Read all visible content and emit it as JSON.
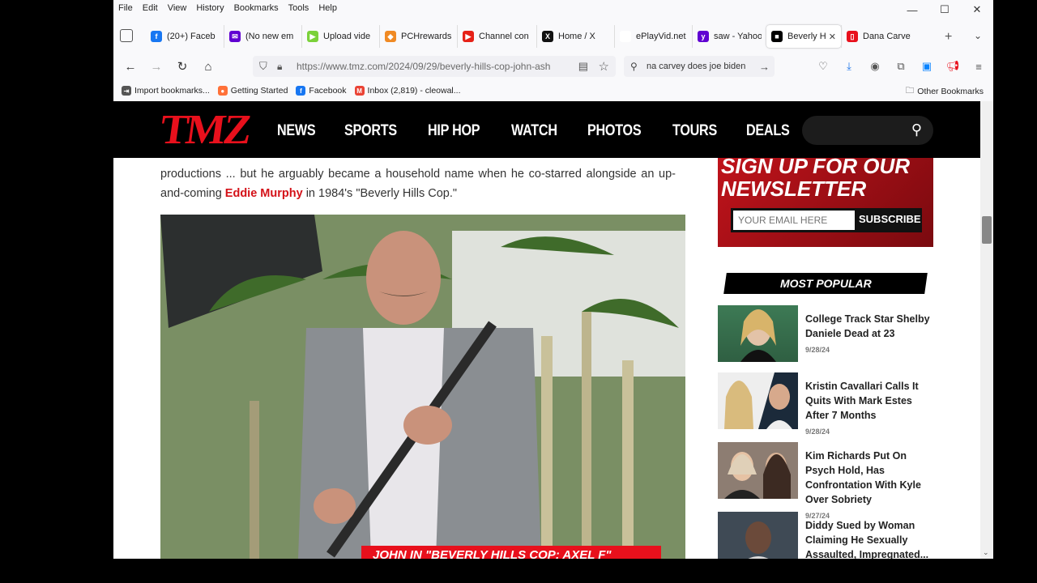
{
  "menu": [
    "File",
    "Edit",
    "View",
    "History",
    "Bookmarks",
    "Tools",
    "Help"
  ],
  "tabs": [
    {
      "label": "(20+) Faceb",
      "favicon": "facebook-icon",
      "color": "#1877f2",
      "glyph": "f"
    },
    {
      "label": "(No new em",
      "favicon": "yahoo-mail-icon",
      "color": "#6001d2",
      "glyph": "✉"
    },
    {
      "label": "Upload vide",
      "favicon": "upload-icon",
      "color": "#7bd13a",
      "glyph": "▶"
    },
    {
      "label": "PCHrewards",
      "favicon": "pch-icon",
      "color": "#f08a24",
      "glyph": "◆"
    },
    {
      "label": "Channel con",
      "favicon": "youtube-icon",
      "color": "#e62117",
      "glyph": "▶"
    },
    {
      "label": "Home / X",
      "favicon": "x-icon",
      "color": "#111111",
      "glyph": "X"
    },
    {
      "label": "ePlayVid.net - Cl",
      "favicon": "eplayvid-icon",
      "color": "#ffffff",
      "glyph": ""
    },
    {
      "label": "saw - Yahoo",
      "favicon": "yahoo-icon",
      "color": "#6001d2",
      "glyph": "y"
    },
    {
      "label": "Beverly H",
      "favicon": "tmz-icon",
      "color": "#000000",
      "glyph": "■",
      "active": true
    },
    {
      "label": "Dana Carvey",
      "favicon": "imdb-icon",
      "color": "#e8101c",
      "glyph": "▯"
    }
  ],
  "url": "https://www.tmz.com/2024/09/29/beverly-hills-cop-john-ash",
  "search_text": "na carvey does joe biden",
  "bookmarks": [
    {
      "label": "Import bookmarks...",
      "icon": "import-icon",
      "color": "#555555",
      "glyph": "⇥"
    },
    {
      "label": "Getting Started",
      "icon": "firefox-icon",
      "color": "#ff7139",
      "glyph": "●"
    },
    {
      "label": "Facebook",
      "icon": "facebook-icon",
      "color": "#1877f2",
      "glyph": "f"
    },
    {
      "label": "Inbox (2,819) - cleowal...",
      "icon": "gmail-icon",
      "color": "#ea4335",
      "glyph": "M"
    }
  ],
  "other_bookmarks": "Other Bookmarks",
  "tmz": {
    "logo": "TMZ",
    "nav": [
      "NEWS",
      "SPORTS",
      "HIP HOP",
      "WATCH",
      "PHOTOS",
      "TOURS",
      "DEALS"
    ]
  },
  "article": {
    "text_before": "productions ... but he arguably became a household name when he co-starred alongside an up-and-coming ",
    "link": "Eddie Murphy",
    "text_after": " in 1984's \"Beverly Hills Cop.\"",
    "caption": "JOHN IN \"BEVERLY HILLS COP: AXEL F\""
  },
  "signup": {
    "title": "SIGN UP FOR OUR NEWSLETTER",
    "email_placeholder": "YOUR EMAIL HERE",
    "button": "SUBSCRIBE"
  },
  "most_popular": {
    "heading": "MOST POPULAR",
    "items": [
      {
        "title": "College Track Star Shelby Daniele Dead at 23",
        "date": "9/28/24"
      },
      {
        "title": "Kristin Cavallari Calls It Quits With Mark Estes After 7 Months",
        "date": "9/28/24"
      },
      {
        "title": "Kim Richards Put On Psych Hold, Has Confrontation With Kyle Over Sobriety",
        "date": "9/27/24"
      },
      {
        "title": "Diddy Sued by Woman Claiming He Sexually Assaulted, Impregnated...",
        "date": ""
      }
    ]
  }
}
